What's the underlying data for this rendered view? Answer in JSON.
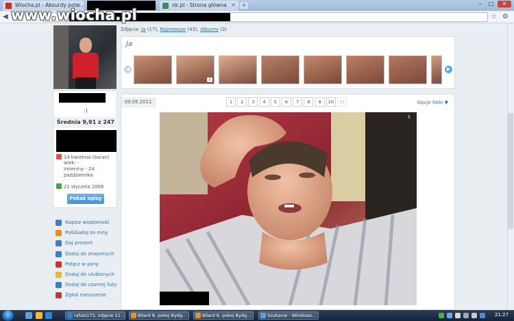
{
  "watermark": "www.wiocha.pl",
  "tabs": [
    {
      "label": "Wiocha.pl - Absurdy pols...",
      "state": "inactive"
    },
    {
      "label": "nk.pl - Strona główna",
      "state": "inactive"
    }
  ],
  "window_buttons": {
    "minimize": "–",
    "maximize": "□",
    "close": "✕"
  },
  "new_tab": "+",
  "photos_nav": {
    "prefix": "Zdjęcia:",
    "ja": "Ja",
    "ja_count": "(17)",
    "najnowsze": "Najnowsze",
    "najnowsze_count": "(43)",
    "albumy": "Albumy",
    "albumy_count": "(3)"
  },
  "album": {
    "title": "Ja",
    "prev": "◀",
    "next": "▶",
    "badge": "5"
  },
  "profile": {
    "status": ":)",
    "rating": "Średnia 9,91 z 247",
    "birthday": "14 kwietnia (baran)",
    "age": "wiek: -",
    "nameday": "Imieniny - 24 października",
    "joined": "21 stycznia 2008",
    "show_descriptions": "Pokaż opisy"
  },
  "actions": [
    {
      "label": "Napisz wiadomość",
      "icon": "envelope-icon",
      "color": "#3a7ec4"
    },
    {
      "label": "PoGGadaj ze mną",
      "icon": "flower-icon",
      "color": "#f28a1c"
    },
    {
      "label": "Daj prezent",
      "icon": "gift-icon",
      "color": "#3a7ec4"
    },
    {
      "label": "Dodaj do znajomych",
      "icon": "people-icon",
      "color": "#3a7ec4"
    },
    {
      "label": "Połącz w parę",
      "icon": "heart-icon",
      "color": "#d23030"
    },
    {
      "label": "Dodaj do ulubionych",
      "icon": "star-icon",
      "color": "#f2b71c"
    },
    {
      "label": "Dodaj do czarnej listy",
      "icon": "person-block-icon",
      "color": "#3a7ec4"
    },
    {
      "label": "Zgłoś naruszenie",
      "icon": "warning-icon",
      "color": "#d23030"
    }
  ],
  "photo": {
    "date": "09.05.2011",
    "pages": [
      "1",
      "2",
      "3",
      "4",
      "5",
      "6",
      "7",
      "8",
      "9",
      "10",
      "11"
    ],
    "options": "Opcje fotki ▼",
    "badge": "5"
  },
  "taskbar": {
    "apps": [
      {
        "label": "rafals173, zdjęcie 11 ..."
      },
      {
        "label": "Bilard 8, pokoj Bydg..."
      },
      {
        "label": "Bilard 8, pokoj Bydg..."
      },
      {
        "label": "Szukanie - Windows..."
      }
    ],
    "clock": "21:27"
  },
  "colors": {
    "link": "#2a74b8",
    "rating_bg": "#eef2f6",
    "button": "#4394d4"
  }
}
